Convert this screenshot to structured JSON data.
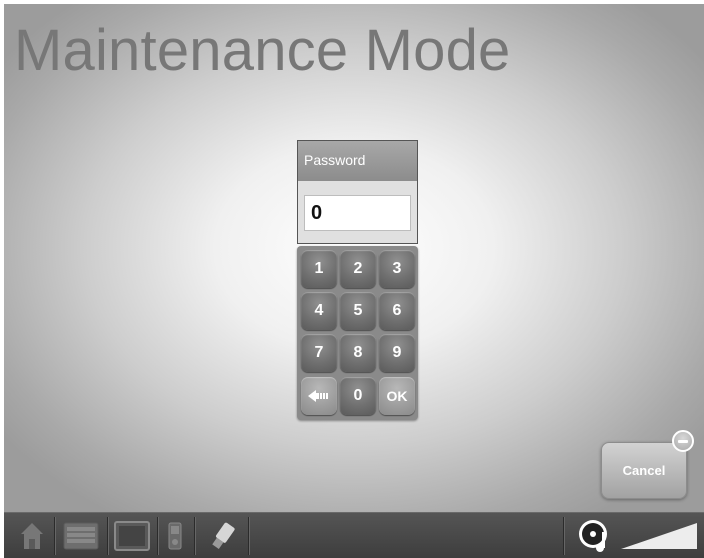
{
  "page": {
    "title": "Maintenance Mode"
  },
  "password_dialog": {
    "label": "Password",
    "value": "0"
  },
  "keypad": {
    "keys": [
      "1",
      "2",
      "3",
      "4",
      "5",
      "6",
      "7",
      "8",
      "9",
      "",
      "0",
      "OK"
    ]
  },
  "cancel_button": {
    "label": "Cancel"
  },
  "taskbar": {
    "icons": [
      "home-icon",
      "keyboard-icon",
      "monitor-icon",
      "media-player-icon",
      "usb-drive-icon",
      "music-note-icon",
      "volume-level-icon"
    ]
  }
}
